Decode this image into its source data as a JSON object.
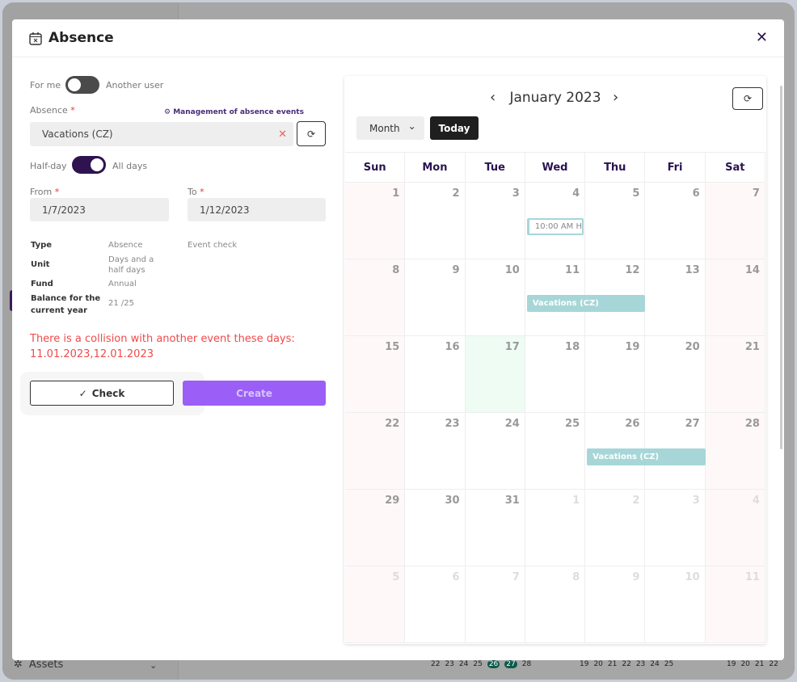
{
  "background": {
    "sidebar_item": "Assets",
    "nums1": [
      "22",
      "23",
      "24",
      "25",
      "26",
      "27",
      "28"
    ],
    "nums2": [
      "19",
      "20",
      "21",
      "22",
      "23",
      "24",
      "25"
    ],
    "nums3": [
      "19",
      "20",
      "21",
      "22"
    ]
  },
  "modal": {
    "title": "Absence",
    "close": "✕"
  },
  "form": {
    "for_me": "For me",
    "another_user": "Another user",
    "for_me_on": false,
    "absence_label": "Absence",
    "required": "*",
    "management_link": "Management of absence events",
    "absence_value": "Vacations (CZ)",
    "clear": "✕",
    "refresh": "⟳",
    "half_day": "Half-day",
    "all_days": "All days",
    "all_days_on": true,
    "from_label": "From",
    "from_value": "1/7/2023",
    "to_label": "To",
    "to_value": "1/12/2023",
    "info": {
      "type_label": "Type",
      "type_value": "Absence",
      "event_check": "Event check",
      "unit_label": "Unit",
      "unit_value": "Days and a half days",
      "fund_label": "Fund",
      "fund_value": "Annual",
      "balance_label": "Balance for the current year",
      "balance_value": "21 /25"
    },
    "error": "There is a collision with another event these days: 11.01.2023,12.01.2023",
    "check": "Check",
    "check_icon": "✓",
    "create": "Create"
  },
  "calendar": {
    "title": "January 2023",
    "prev": "‹",
    "next": "›",
    "refresh": "⟳",
    "view": "Month",
    "view_arrow": "⌄",
    "today": "Today",
    "weekdays": [
      "Sun",
      "Mon",
      "Tue",
      "Wed",
      "Thu",
      "Fri",
      "Sat"
    ],
    "weeks": [
      [
        "1",
        "2",
        "3",
        "4",
        "5",
        "6",
        "7"
      ],
      [
        "8",
        "9",
        "10",
        "11",
        "12",
        "13",
        "14"
      ],
      [
        "15",
        "16",
        "17",
        "18",
        "19",
        "20",
        "21"
      ],
      [
        "22",
        "23",
        "24",
        "25",
        "26",
        "27",
        "28"
      ],
      [
        "29",
        "30",
        "31",
        "1",
        "2",
        "3",
        "4"
      ],
      [
        "5",
        "6",
        "7",
        "8",
        "9",
        "10",
        "11"
      ]
    ],
    "today_date": "17",
    "events": [
      {
        "label": "10:00 AM H",
        "week": 0,
        "start": 3,
        "span": 1,
        "style": "outline"
      },
      {
        "label": "Vacations (CZ)",
        "week": 1,
        "start": 3,
        "span": 2,
        "style": "fill"
      },
      {
        "label": "Vacations (CZ)",
        "week": 3,
        "start": 4,
        "span": 2,
        "style": "fill"
      }
    ],
    "colors": {
      "accent": "#2a1450",
      "event": "#a7d6d8",
      "create": "#9b5ff7",
      "error": "#f04a4a"
    }
  }
}
